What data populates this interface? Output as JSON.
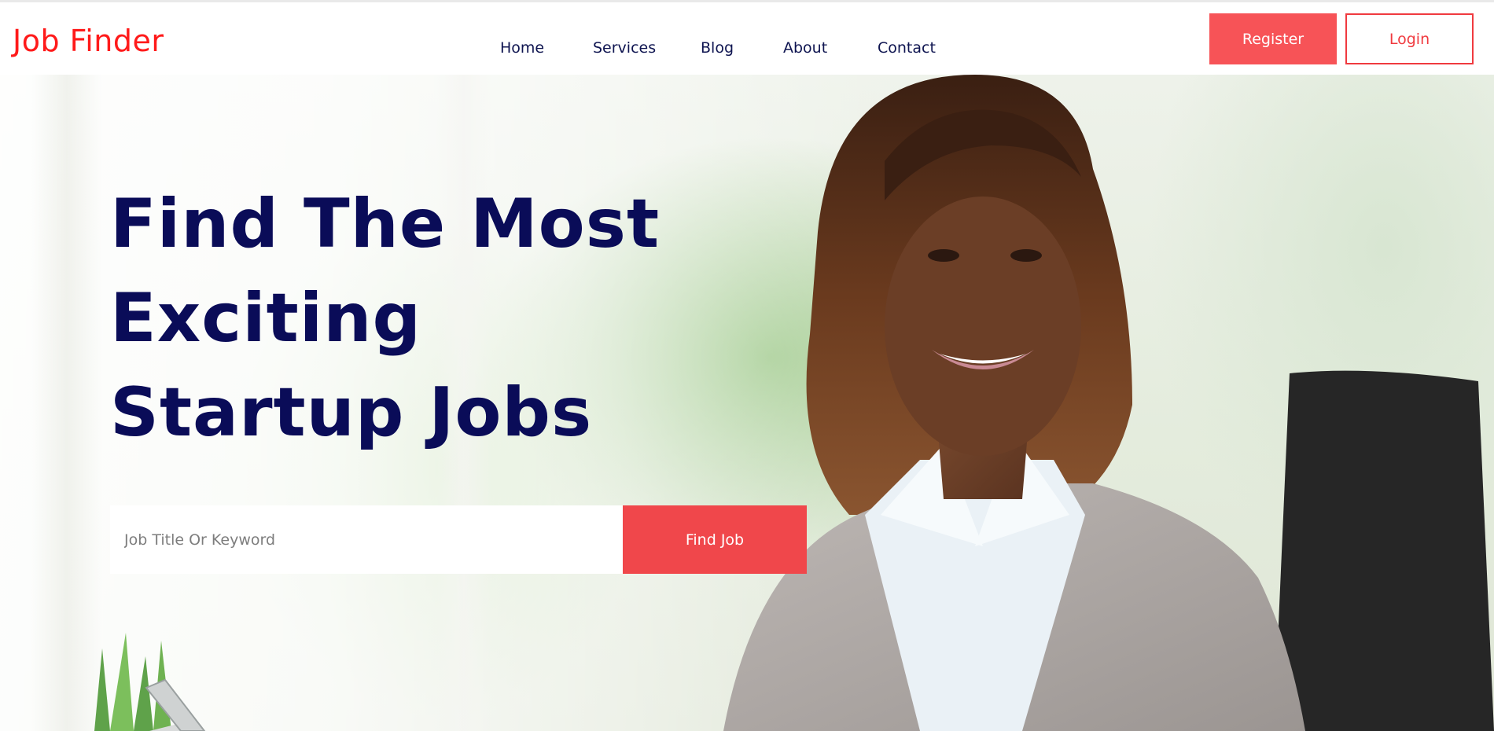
{
  "header": {
    "logo": "Job Finder",
    "nav": [
      {
        "label": "Home"
      },
      {
        "label": "Services"
      },
      {
        "label": "Blog"
      },
      {
        "label": "About"
      },
      {
        "label": "Contact"
      }
    ],
    "register_label": "Register",
    "login_label": "Login"
  },
  "hero": {
    "headline_lines": [
      "Find The Most",
      "Exciting",
      "Startup Jobs"
    ],
    "search": {
      "placeholder": "Job Title Or Keyword",
      "value": "",
      "button_label": "Find Job"
    }
  },
  "colors": {
    "brand_red": "#ff1a1a",
    "accent": "#f0474b",
    "navy": "#0a0c58"
  }
}
